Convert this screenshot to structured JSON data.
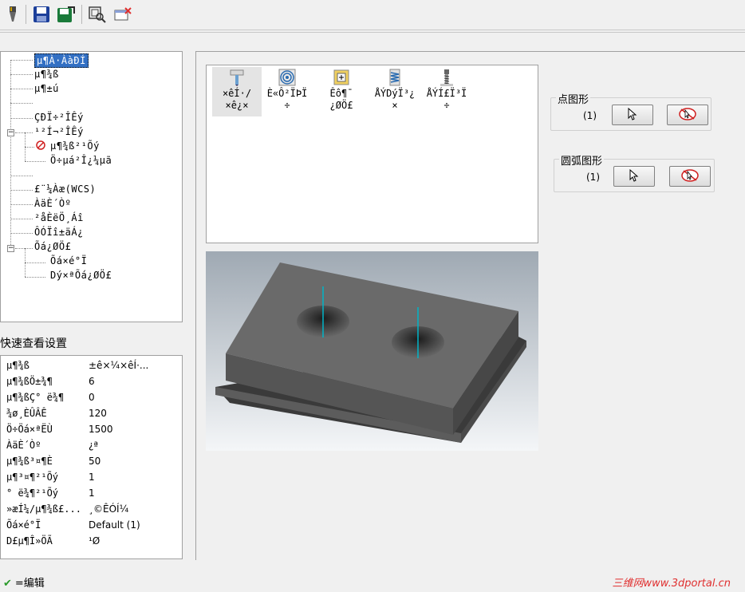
{
  "toolbar": {
    "icons": [
      "torch-icon",
      "save-icon",
      "save-as-icon",
      "preview-icon",
      "close-icon"
    ]
  },
  "tree": {
    "items": [
      {
        "label": "µ¶À·ÀàÐÍ",
        "selected": true
      },
      {
        "label": "µ¶¾ß"
      },
      {
        "label": "µ¶±ú"
      },
      {
        "label": ""
      },
      {
        "label": "ÇÐÏ÷²ÎÊý"
      },
      {
        "label": "¹²Í¬²ÎÊý"
      },
      {
        "label": "µ¶¾ß²¹Õý"
      },
      {
        "label": "Ö÷µá²Î¿¼µã"
      },
      {
        "label": ""
      },
      {
        "label": "£¨¼Àæ(WCS)"
      },
      {
        "label": "ÀäÈ´Òº"
      },
      {
        "label": "²åÈëÖ¸Áî"
      },
      {
        "label": "ÔÓÏî±äÁ¿"
      },
      {
        "label": "Õá¿ØÖ£"
      },
      {
        "label": "Õá×é°Ï"
      },
      {
        "label": "Dý×ªÕá¿ØÖ£"
      }
    ]
  },
  "quick_view": {
    "title": "快速查看设置",
    "rows": [
      {
        "key": "µ¶¾ß",
        "value": "±ê×¼×êÍ·..."
      },
      {
        "key": "µ¶¾ßÖ±¾¶",
        "value": "6"
      },
      {
        "key": "µ¶¾ßÇ° ë¾¶",
        "value": "0"
      },
      {
        "key": "¾ø¸ÈÛÂÊ",
        "value": "120"
      },
      {
        "key": "Ö÷Öá×ªËÙ",
        "value": "1500"
      },
      {
        "key": "ÀäÈ´Òº",
        "value": "¿ª"
      },
      {
        "key": "µ¶¾ß³¤¶È",
        "value": "50"
      },
      {
        "key": "µ¶³¤¶²¹Õý",
        "value": "1"
      },
      {
        "key": "° ë¾¶²¹Õý",
        "value": "1"
      },
      {
        "key": "»æÍ¼/µ¶¾ß£...",
        "value": "¸©ÊÓÍ¼"
      },
      {
        "key": "Õá×é°Ï",
        "value": "Default (1)"
      },
      {
        "key": "D£µ¶Î»ÖÃ",
        "value": "¹Ø"
      }
    ]
  },
  "operations": [
    {
      "icon": "drill-icon",
      "label": "×êÍ·/\n×ê¿×",
      "active": true
    },
    {
      "icon": "spiral-icon",
      "label": "È«Ô²ÏÞÏ\n÷"
    },
    {
      "icon": "mill-icon",
      "label": "Êô¶¯\n¿ØÖ£"
    },
    {
      "icon": "spring-tap-icon",
      "label": "ÅÝDýÏ³¿\n×"
    },
    {
      "icon": "tap-icon",
      "label": "ÅÝÍ£Ï³Ï\n÷"
    }
  ],
  "point_group": {
    "title": "点图形",
    "count": "(1)"
  },
  "arc_group": {
    "title": "圆弧图形",
    "count": "(1)"
  },
  "status": {
    "text": "=编辑"
  },
  "watermark": "三维网www.3dportal.cn",
  "colors": {
    "selection": "#3370c4",
    "accent_red": "#e03030",
    "axis_cyan": "#00b5c8"
  }
}
